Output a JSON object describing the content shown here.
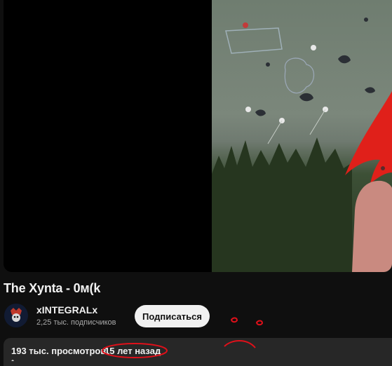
{
  "video": {
    "title": "The Xynta - 0м(k"
  },
  "channel": {
    "name": "xINTEGRALx",
    "subscribers": "2,25 тыс. подписчиков",
    "subscribe_label": "Подписаться"
  },
  "description": {
    "views": "193 тыс. просмотров",
    "age": "15 лет назад"
  },
  "colors": {
    "page_background": "#0f0f0f",
    "description_background": "#272727",
    "subscribe_button": "#f1f1f1",
    "annotation_red": "#e0101a"
  }
}
